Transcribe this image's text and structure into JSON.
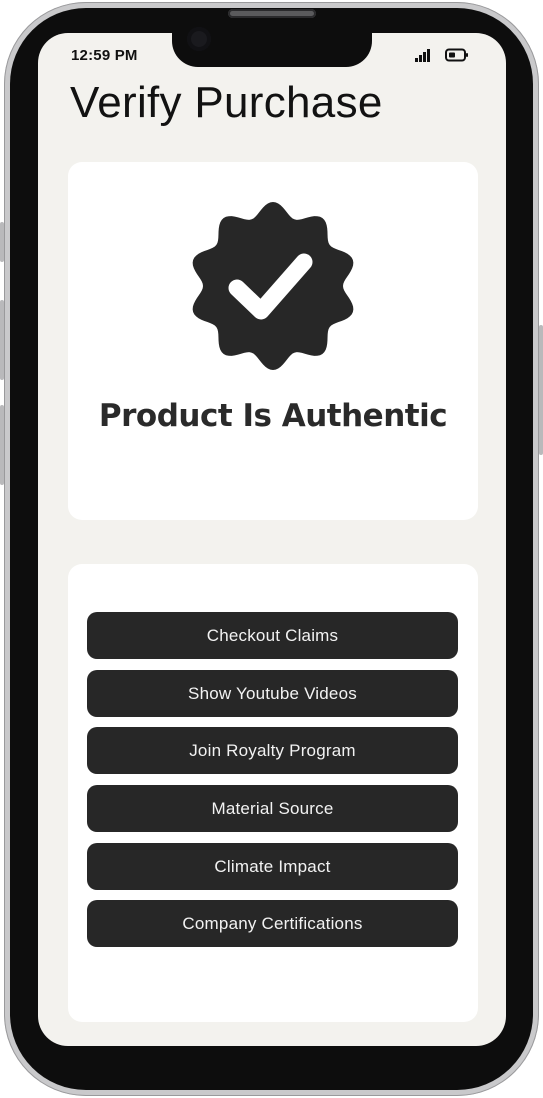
{
  "status_bar": {
    "time": "12:59 PM",
    "signal_icon": "signal-bars-icon",
    "battery_icon": "battery-icon"
  },
  "page": {
    "title": "Verify Purchase"
  },
  "verification": {
    "badge_icon": "verified-badge-check-icon",
    "message": "Product Is Authentic"
  },
  "actions": [
    {
      "label": "Checkout Claims"
    },
    {
      "label": "Show Youtube Videos"
    },
    {
      "label": "Join Royalty Program"
    },
    {
      "label": "Material Source"
    },
    {
      "label": "Climate Impact"
    },
    {
      "label": "Company Certifications"
    }
  ],
  "colors": {
    "screen_background": "#f3f2ee",
    "card_background": "#ffffff",
    "button_background": "#272727",
    "button_text": "#f2f2f2",
    "badge": "#272727"
  }
}
